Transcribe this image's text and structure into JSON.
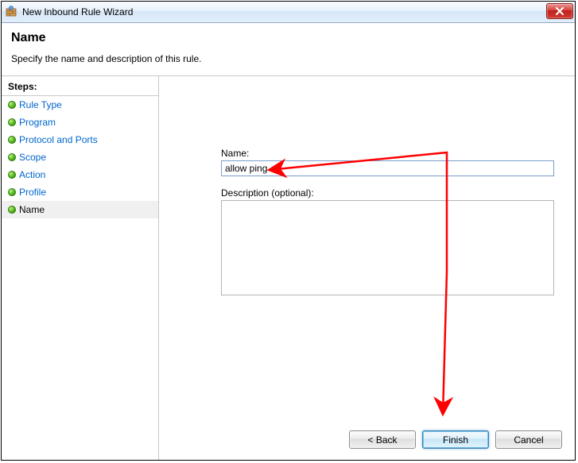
{
  "window": {
    "title": "New Inbound Rule Wizard"
  },
  "header": {
    "title": "Name",
    "subtitle": "Specify the name and description of this rule."
  },
  "sidebar": {
    "title": "Steps:",
    "items": [
      {
        "label": "Rule Type"
      },
      {
        "label": "Program"
      },
      {
        "label": "Protocol and Ports"
      },
      {
        "label": "Scope"
      },
      {
        "label": "Action"
      },
      {
        "label": "Profile"
      },
      {
        "label": "Name"
      }
    ]
  },
  "form": {
    "name_label": "Name:",
    "name_value": "allow ping",
    "description_label": "Description (optional):",
    "description_value": ""
  },
  "buttons": {
    "back": "< Back",
    "finish": "Finish",
    "cancel": "Cancel"
  }
}
